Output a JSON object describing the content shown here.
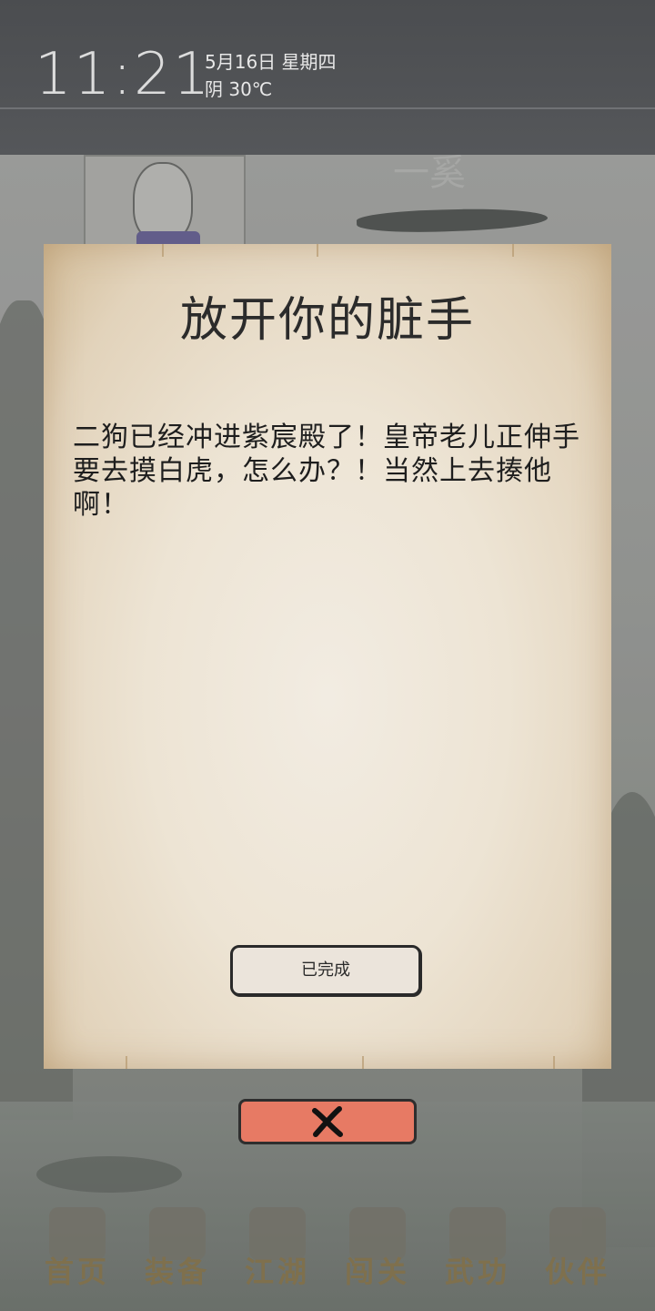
{
  "status": {
    "time": "11:21",
    "date": "5月16日 星期四",
    "weather": "阴 30℃"
  },
  "scene": {
    "banner_text": "一奚"
  },
  "dialog": {
    "title": "放开你的脏手",
    "body": "二狗已经冲进紫宸殿了！皇帝老儿正伸手要去摸白虎，怎么办？！当然上去揍他啊！",
    "done_label": "已完成",
    "close_icon": "close-icon"
  },
  "nav": {
    "items": [
      {
        "label": "首页",
        "icon": "home-icon"
      },
      {
        "label": "装备",
        "icon": "equipment-icon"
      },
      {
        "label": "江湖",
        "icon": "jianghu-icon"
      },
      {
        "label": "闯关",
        "icon": "battle-icon"
      },
      {
        "label": "武功",
        "icon": "martial-arts-icon"
      },
      {
        "label": "伙伴",
        "icon": "partner-icon"
      }
    ]
  },
  "colors": {
    "parchment": "#ede4d4",
    "close_button": "#e77a64",
    "status_bar": "#4b4d50"
  }
}
